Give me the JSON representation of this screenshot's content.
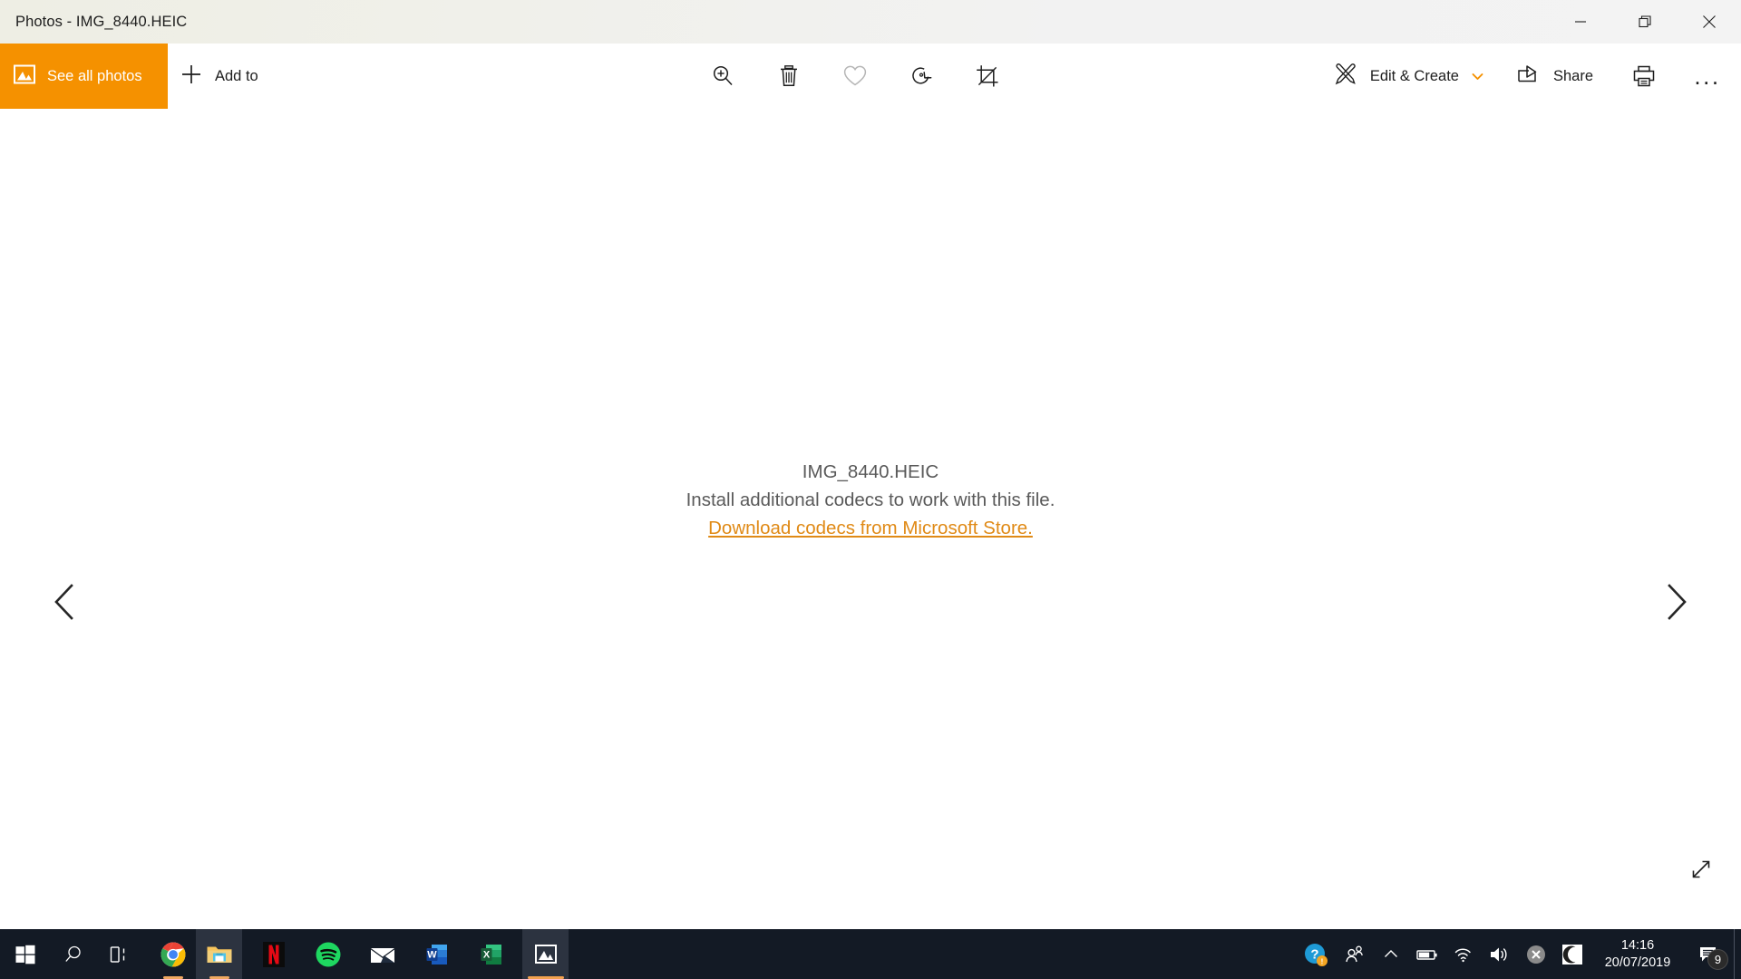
{
  "window": {
    "title": "Photos - IMG_8440.HEIC",
    "controls": {
      "minimize": "minimize-button",
      "restore": "restore-button",
      "close": "close-button"
    }
  },
  "toolbar": {
    "see_all_photos_label": "See all photos",
    "add_to_label": "Add to",
    "edit_create_label": "Edit & Create",
    "share_label": "Share",
    "center_tools": [
      {
        "name": "zoom-in-icon",
        "tooltip": "Zoom"
      },
      {
        "name": "delete-icon",
        "tooltip": "Delete"
      },
      {
        "name": "heart-icon",
        "tooltip": "Add to favorites"
      },
      {
        "name": "rotate-icon",
        "tooltip": "Rotate"
      },
      {
        "name": "crop-icon",
        "tooltip": "Crop & rotate"
      }
    ],
    "print_icon": "printer-icon",
    "more_icon": "more-options-icon",
    "more_label": "...",
    "accent_color": "#f59100"
  },
  "viewer": {
    "filename": "IMG_8440.HEIC",
    "message": "Install additional codecs to work with this file.",
    "link_text": "Download codecs from Microsoft Store.",
    "link_color": "#e08a16",
    "text_color": "#5a5a5a",
    "prev_icon": "chevron-left-icon",
    "next_icon": "chevron-right-icon",
    "fullscreen_icon": "fullscreen-expand-icon"
  },
  "taskbar": {
    "background_color": "#131a25",
    "start_icon": "windows-start-icon",
    "search_icon": "search-icon",
    "taskview_icon": "task-view-icon",
    "apps": [
      {
        "name": "taskbar-app-chrome",
        "label": "Google Chrome",
        "active": false,
        "running": true
      },
      {
        "name": "taskbar-app-explorer",
        "label": "File Explorer",
        "active": false,
        "running": true
      },
      {
        "name": "taskbar-app-netflix",
        "label": "Netflix",
        "active": false,
        "running": false
      },
      {
        "name": "taskbar-app-spotify",
        "label": "Spotify",
        "active": false,
        "running": false
      },
      {
        "name": "taskbar-app-mail",
        "label": "Mail",
        "active": false,
        "running": false
      },
      {
        "name": "taskbar-app-word",
        "label": "Word",
        "active": false,
        "running": false
      },
      {
        "name": "taskbar-app-excel",
        "label": "Excel",
        "active": false,
        "running": false
      },
      {
        "name": "taskbar-app-photos",
        "label": "Photos",
        "active": true,
        "running": true
      }
    ],
    "tray": [
      {
        "name": "help-icon",
        "label": "Get Help"
      },
      {
        "name": "people-icon",
        "label": "People"
      },
      {
        "name": "show-hidden-icons-icon",
        "label": "Show hidden icons"
      },
      {
        "name": "battery-icon",
        "label": "Battery"
      },
      {
        "name": "wifi-icon",
        "label": "Network"
      },
      {
        "name": "volume-icon",
        "label": "Volume"
      },
      {
        "name": "error-icon",
        "label": "Error"
      },
      {
        "name": "night-light-icon",
        "label": "Night light"
      }
    ],
    "clock": {
      "time": "14:16",
      "date": "20/07/2019"
    },
    "notifications": {
      "icon": "notifications-icon",
      "count": "9"
    }
  }
}
